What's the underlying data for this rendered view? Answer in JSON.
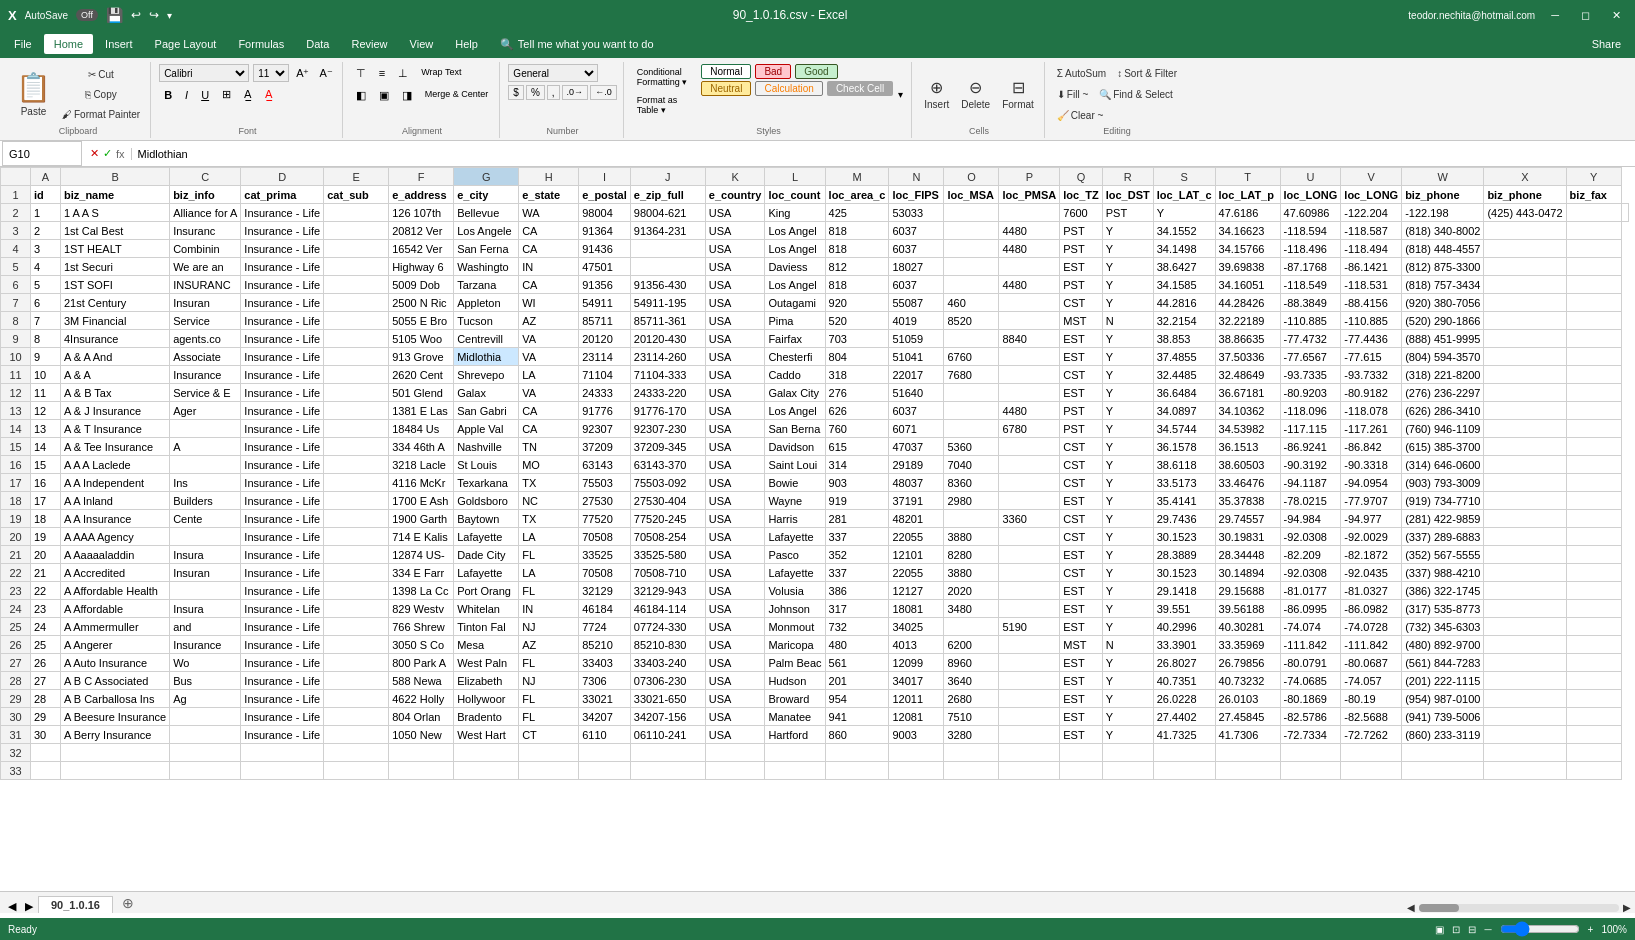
{
  "titlebar": {
    "autosave": "AutoSave",
    "autosave_state": "Off",
    "filename": "90_1.0.16.csv - Excel",
    "user_email": "teodor.nechita@hotmail.com"
  },
  "menu": {
    "items": [
      "File",
      "Home",
      "Insert",
      "Page Layout",
      "Formulas",
      "Data",
      "Review",
      "View",
      "Help"
    ]
  },
  "ribbon": {
    "clipboard": {
      "label": "Clipboard",
      "paste": "Paste",
      "cut": "Cut",
      "copy": "Copy",
      "format_painter": "Format Painter"
    },
    "font": {
      "label": "Font",
      "name": "Calibri",
      "size": "11"
    },
    "alignment": {
      "label": "Alignment",
      "wrap_text": "Wrap Text",
      "merge_center": "Merge & Center"
    },
    "number": {
      "label": "Number",
      "format": "General"
    },
    "styles": {
      "label": "Styles",
      "normal": "Normal",
      "bad": "Bad",
      "good": "Good",
      "neutral": "Neutral",
      "calculation": "Calculation",
      "check_cell": "Check Cell"
    },
    "cells": {
      "label": "Cells",
      "insert": "Insert",
      "delete": "Delete",
      "format": "Format"
    },
    "editing": {
      "label": "Editing",
      "autosum": "AutoSum",
      "fill": "Fill ~",
      "clear": "Clear ~",
      "sort_filter": "Sort & Filter",
      "find_select": "Find & Select"
    }
  },
  "formula_bar": {
    "cell_ref": "G10",
    "formula": "Midlothian"
  },
  "columns": [
    "",
    "A",
    "B",
    "C",
    "D",
    "E",
    "F",
    "G",
    "H",
    "I",
    "J",
    "K",
    "L",
    "M",
    "N",
    "O",
    "P",
    "Q",
    "R",
    "S",
    "T",
    "U",
    "V",
    "W",
    "X",
    "Y"
  ],
  "col_headers": [
    "id",
    "biz_name",
    "biz_info",
    "cat_prima",
    "cat_sub",
    "e_address",
    "e_city",
    "e_state",
    "e_postal",
    "e_zip_full",
    "e_country",
    "loc_count",
    "loc_area_c",
    "loc_FIPS",
    "loc_MSA",
    "loc_PMSA",
    "loc_TZ",
    "loc_DST",
    "loc_LAT_c",
    "loc_LAT_p",
    "loc_LONG",
    "loc_LONG",
    "biz_phone",
    "biz_phone",
    "biz_fax"
  ],
  "rows": [
    [
      "1",
      "1 A A S",
      "Alliance for A",
      "Insurance - Life",
      "",
      "126 107th",
      "Bellevue",
      "WA",
      "98004",
      "98004-621",
      "USA",
      "King",
      "425",
      "53033",
      "",
      "",
      "7600",
      "PST",
      "Y",
      "47.6186",
      "47.60986",
      "-122.204",
      "-122.198",
      "(425) 443-0472",
      "",
      ""
    ],
    [
      "2",
      "1st Cal Best",
      "Insuranc",
      "Insurance - Life",
      "",
      "20812 Ver",
      "Los Angele",
      "CA",
      "91364",
      "91364-231",
      "USA",
      "Los Angel",
      "818",
      "6037",
      "",
      "4480",
      "PST",
      "Y",
      "34.1552",
      "34.16623",
      "-118.594",
      "-118.587",
      "(818) 340-8002",
      "",
      ""
    ],
    [
      "3",
      "1ST HEALT",
      "Combinin",
      "Insurance - Life",
      "",
      "16542 Ver",
      "San Ferna",
      "CA",
      "91436",
      "",
      "USA",
      "Los Angel",
      "818",
      "6037",
      "",
      "4480",
      "PST",
      "Y",
      "34.1498",
      "34.15766",
      "-118.496",
      "-118.494",
      "(818) 448-4557",
      "",
      ""
    ],
    [
      "4",
      "1st Securi",
      "We are an",
      "Insurance - Life",
      "",
      "Highway 6",
      "Washingto",
      "IN",
      "47501",
      "",
      "USA",
      "Daviess",
      "812",
      "18027",
      "",
      "",
      "EST",
      "Y",
      "38.6427",
      "39.69838",
      "-87.1768",
      "-86.1421",
      "(812) 875-3300",
      "",
      ""
    ],
    [
      "5",
      "1ST SOFI",
      "INSURANC",
      "Insurance - Life",
      "",
      "5009 Dob",
      "Tarzana",
      "CA",
      "91356",
      "91356-430",
      "USA",
      "Los Angel",
      "818",
      "6037",
      "",
      "4480",
      "PST",
      "Y",
      "34.1585",
      "34.16051",
      "-118.549",
      "-118.531",
      "(818) 757-3434",
      "",
      ""
    ],
    [
      "6",
      "21st Century",
      "Insuran",
      "Insurance - Life",
      "",
      "2500 N Ric",
      "Appleton",
      "WI",
      "54911",
      "54911-195",
      "USA",
      "Outagami",
      "920",
      "55087",
      "460",
      "",
      "CST",
      "Y",
      "44.2816",
      "44.28426",
      "-88.3849",
      "-88.4156",
      "(920) 380-7056",
      "",
      ""
    ],
    [
      "7",
      "3M Financial",
      "Service",
      "Insurance - Life",
      "",
      "5055 E Bro",
      "Tucson",
      "AZ",
      "85711",
      "85711-361",
      "USA",
      "Pima",
      "520",
      "4019",
      "8520",
      "",
      "MST",
      "N",
      "32.2154",
      "32.22189",
      "-110.885",
      "-110.885",
      "(520) 290-1866",
      "",
      ""
    ],
    [
      "8",
      "4Insurance",
      "agents.co",
      "Insurance - Life",
      "",
      "5105 Woo",
      "Centrevill",
      "VA",
      "20120",
      "20120-430",
      "USA",
      "Fairfax",
      "703",
      "51059",
      "",
      "8840",
      "EST",
      "Y",
      "38.853",
      "38.86635",
      "-77.4732",
      "-77.4436",
      "(888) 451-9995",
      "",
      ""
    ],
    [
      "9",
      "A & A And",
      "Associate",
      "Insurance - Life",
      "",
      "913 Grove",
      "Midlothia",
      "VA",
      "23114",
      "23114-260",
      "USA",
      "Chesterfi",
      "804",
      "51041",
      "6760",
      "",
      "EST",
      "Y",
      "37.4855",
      "37.50336",
      "-77.6567",
      "-77.615",
      "(804) 594-3570",
      "",
      ""
    ],
    [
      "10",
      "A & A",
      "Insurance",
      "Insurance - Life",
      "",
      "2620 Cent",
      "Shrevepo",
      "LA",
      "71104",
      "71104-333",
      "USA",
      "Caddo",
      "318",
      "22017",
      "7680",
      "",
      "CST",
      "Y",
      "32.4485",
      "32.48649",
      "-93.7335",
      "-93.7332",
      "(318) 221-8200",
      "",
      ""
    ],
    [
      "11",
      "A & B Tax",
      "Service & E",
      "Insurance - Life",
      "",
      "501 Glend",
      "Galax",
      "VA",
      "24333",
      "24333-220",
      "USA",
      "Galax City",
      "276",
      "51640",
      "",
      "",
      "EST",
      "Y",
      "36.6484",
      "36.67181",
      "-80.9203",
      "-80.9182",
      "(276) 236-2297",
      "",
      ""
    ],
    [
      "12",
      "A & J Insurance",
      "Ager",
      "Insurance - Life",
      "",
      "1381 E Las",
      "San Gabri",
      "CA",
      "91776",
      "91776-170",
      "USA",
      "Los Angel",
      "626",
      "6037",
      "",
      "4480",
      "PST",
      "Y",
      "34.0897",
      "34.10362",
      "-118.096",
      "-118.078",
      "(626) 286-3410",
      "",
      ""
    ],
    [
      "13",
      "A & T Insurance",
      "",
      "Insurance - Life",
      "",
      "18484 Us",
      "Apple Val",
      "CA",
      "92307",
      "92307-230",
      "USA",
      "San Berna",
      "760",
      "6071",
      "",
      "6780",
      "PST",
      "Y",
      "34.5744",
      "34.53982",
      "-117.115",
      "-117.261",
      "(760) 946-1109",
      "",
      ""
    ],
    [
      "14",
      "A & Tee Insurance",
      "A",
      "Insurance - Life",
      "",
      "334 46th A",
      "Nashville",
      "TN",
      "37209",
      "37209-345",
      "USA",
      "Davidson",
      "615",
      "47037",
      "5360",
      "",
      "CST",
      "Y",
      "36.1578",
      "36.1513",
      "-86.9241",
      "-86.842",
      "(615) 385-3700",
      "",
      ""
    ],
    [
      "15",
      "A A A Laclede",
      "",
      "Insurance - Life",
      "",
      "3218 Lacle",
      "St Louis",
      "MO",
      "63143",
      "63143-370",
      "USA",
      "Saint Loui",
      "314",
      "29189",
      "7040",
      "",
      "CST",
      "Y",
      "38.6118",
      "38.60503",
      "-90.3192",
      "-90.3318",
      "(314) 646-0600",
      "",
      ""
    ],
    [
      "16",
      "A A Independent",
      "Ins",
      "Insurance - Life",
      "",
      "4116 McKr",
      "Texarkana",
      "TX",
      "75503",
      "75503-092",
      "USA",
      "Bowie",
      "903",
      "48037",
      "8360",
      "",
      "CST",
      "Y",
      "33.5173",
      "33.46476",
      "-94.1187",
      "-94.0954",
      "(903) 793-3009",
      "",
      ""
    ],
    [
      "17",
      "A A Inland",
      "Builders",
      "Insurance - Life",
      "",
      "1700 E Ash",
      "Goldsboro",
      "NC",
      "27530",
      "27530-404",
      "USA",
      "Wayne",
      "919",
      "37191",
      "2980",
      "",
      "EST",
      "Y",
      "35.4141",
      "35.37838",
      "-78.0215",
      "-77.9707",
      "(919) 734-7710",
      "",
      ""
    ],
    [
      "18",
      "A A Insurance",
      "Cente",
      "Insurance - Life",
      "",
      "1900 Garth",
      "Baytown",
      "TX",
      "77520",
      "77520-245",
      "USA",
      "Harris",
      "281",
      "48201",
      "",
      "3360",
      "CST",
      "Y",
      "29.7436",
      "29.74557",
      "-94.984",
      "-94.977",
      "(281) 422-9859",
      "",
      ""
    ],
    [
      "19",
      "A AAA Agency",
      "",
      "Insurance - Life",
      "",
      "714 E Kalis",
      "Lafayette",
      "LA",
      "70508",
      "70508-254",
      "USA",
      "Lafayette",
      "337",
      "22055",
      "3880",
      "",
      "CST",
      "Y",
      "30.1523",
      "30.19831",
      "-92.0308",
      "-92.0029",
      "(337) 289-6883",
      "",
      ""
    ],
    [
      "20",
      "A Aaaaaladdin",
      "Insura",
      "Insurance - Life",
      "",
      "12874 US-",
      "Dade City",
      "FL",
      "33525",
      "33525-580",
      "USA",
      "Pasco",
      "352",
      "12101",
      "8280",
      "",
      "EST",
      "Y",
      "28.3889",
      "28.34448",
      "-82.209",
      "-82.1872",
      "(352) 567-5555",
      "",
      ""
    ],
    [
      "21",
      "A Accredited",
      "Insuran",
      "Insurance - Life",
      "",
      "334 E Farr",
      "Lafayette",
      "LA",
      "70508",
      "70508-710",
      "USA",
      "Lafayette",
      "337",
      "22055",
      "3880",
      "",
      "CST",
      "Y",
      "30.1523",
      "30.14894",
      "-92.0308",
      "-92.0435",
      "(337) 988-4210",
      "",
      ""
    ],
    [
      "22",
      "A Affordable Health",
      "",
      "Insurance - Life",
      "",
      "1398 La Cc",
      "Port Orang",
      "FL",
      "32129",
      "32129-943",
      "USA",
      "Volusia",
      "386",
      "12127",
      "2020",
      "",
      "EST",
      "Y",
      "29.1418",
      "29.15688",
      "-81.0177",
      "-81.0327",
      "(386) 322-1745",
      "",
      ""
    ],
    [
      "23",
      "A Affordable",
      "Insura",
      "Insurance - Life",
      "",
      "829 Westv",
      "Whitelan",
      "IN",
      "46184",
      "46184-114",
      "USA",
      "Johnson",
      "317",
      "18081",
      "3480",
      "",
      "EST",
      "Y",
      "39.551",
      "39.56188",
      "-86.0995",
      "-86.0982",
      "(317) 535-8773",
      "",
      ""
    ],
    [
      "24",
      "A Ammermuller",
      "and",
      "Insurance - Life",
      "",
      "766 Shrew",
      "Tinton Fal",
      "NJ",
      "7724",
      "07724-330",
      "USA",
      "Monmout",
      "732",
      "34025",
      "",
      "5190",
      "EST",
      "Y",
      "40.2996",
      "40.30281",
      "-74.074",
      "-74.0728",
      "(732) 345-6303",
      "",
      ""
    ],
    [
      "25",
      "A Angerer",
      "Insurance",
      "Insurance - Life",
      "",
      "3050 S Co",
      "Mesa",
      "AZ",
      "85210",
      "85210-830",
      "USA",
      "Maricopa",
      "480",
      "4013",
      "6200",
      "",
      "MST",
      "N",
      "33.3901",
      "33.35969",
      "-111.842",
      "-111.842",
      "(480) 892-9700",
      "",
      ""
    ],
    [
      "26",
      "A Auto Insurance",
      "Wo",
      "Insurance - Life",
      "",
      "800 Park A",
      "West Paln",
      "FL",
      "33403",
      "33403-240",
      "USA",
      "Palm Beac",
      "561",
      "12099",
      "8960",
      "",
      "EST",
      "Y",
      "26.8027",
      "26.79856",
      "-80.0791",
      "-80.0687",
      "(561) 844-7283",
      "",
      ""
    ],
    [
      "27",
      "A B C Associated",
      "Bus",
      "Insurance - Life",
      "",
      "588 Newa",
      "Elizabeth",
      "NJ",
      "7306",
      "07306-230",
      "USA",
      "Hudson",
      "201",
      "34017",
      "3640",
      "",
      "EST",
      "Y",
      "40.7351",
      "40.73232",
      "-74.0685",
      "-74.057",
      "(201) 222-1115",
      "",
      ""
    ],
    [
      "28",
      "A B Carballosa Ins",
      "Ag",
      "Insurance - Life",
      "",
      "4622 Holly",
      "Hollywoor",
      "FL",
      "33021",
      "33021-650",
      "USA",
      "Broward",
      "954",
      "12011",
      "2680",
      "",
      "EST",
      "Y",
      "26.0228",
      "26.0103",
      "-80.1869",
      "-80.19",
      "(954) 987-0100",
      "",
      ""
    ],
    [
      "29",
      "A Beesure Insurance",
      "",
      "Insurance - Life",
      "",
      "804 Orlan",
      "Bradento",
      "FL",
      "34207",
      "34207-156",
      "USA",
      "Manatee",
      "941",
      "12081",
      "7510",
      "",
      "EST",
      "Y",
      "27.4402",
      "27.45845",
      "-82.5786",
      "-82.5688",
      "(941) 739-5006",
      "",
      ""
    ],
    [
      "30",
      "A Berry Insurance",
      "",
      "Insurance - Life",
      "",
      "1050 New",
      "West Hart",
      "CT",
      "6110",
      "06110-241",
      "USA",
      "Hartford",
      "860",
      "9003",
      "3280",
      "",
      "EST",
      "Y",
      "41.7325",
      "41.7306",
      "-72.7334",
      "-72.7262",
      "(860) 233-3119",
      "",
      ""
    ]
  ],
  "sheet_tabs": [
    "90_1.0.16"
  ],
  "status": "Ready",
  "zoom": "100%"
}
